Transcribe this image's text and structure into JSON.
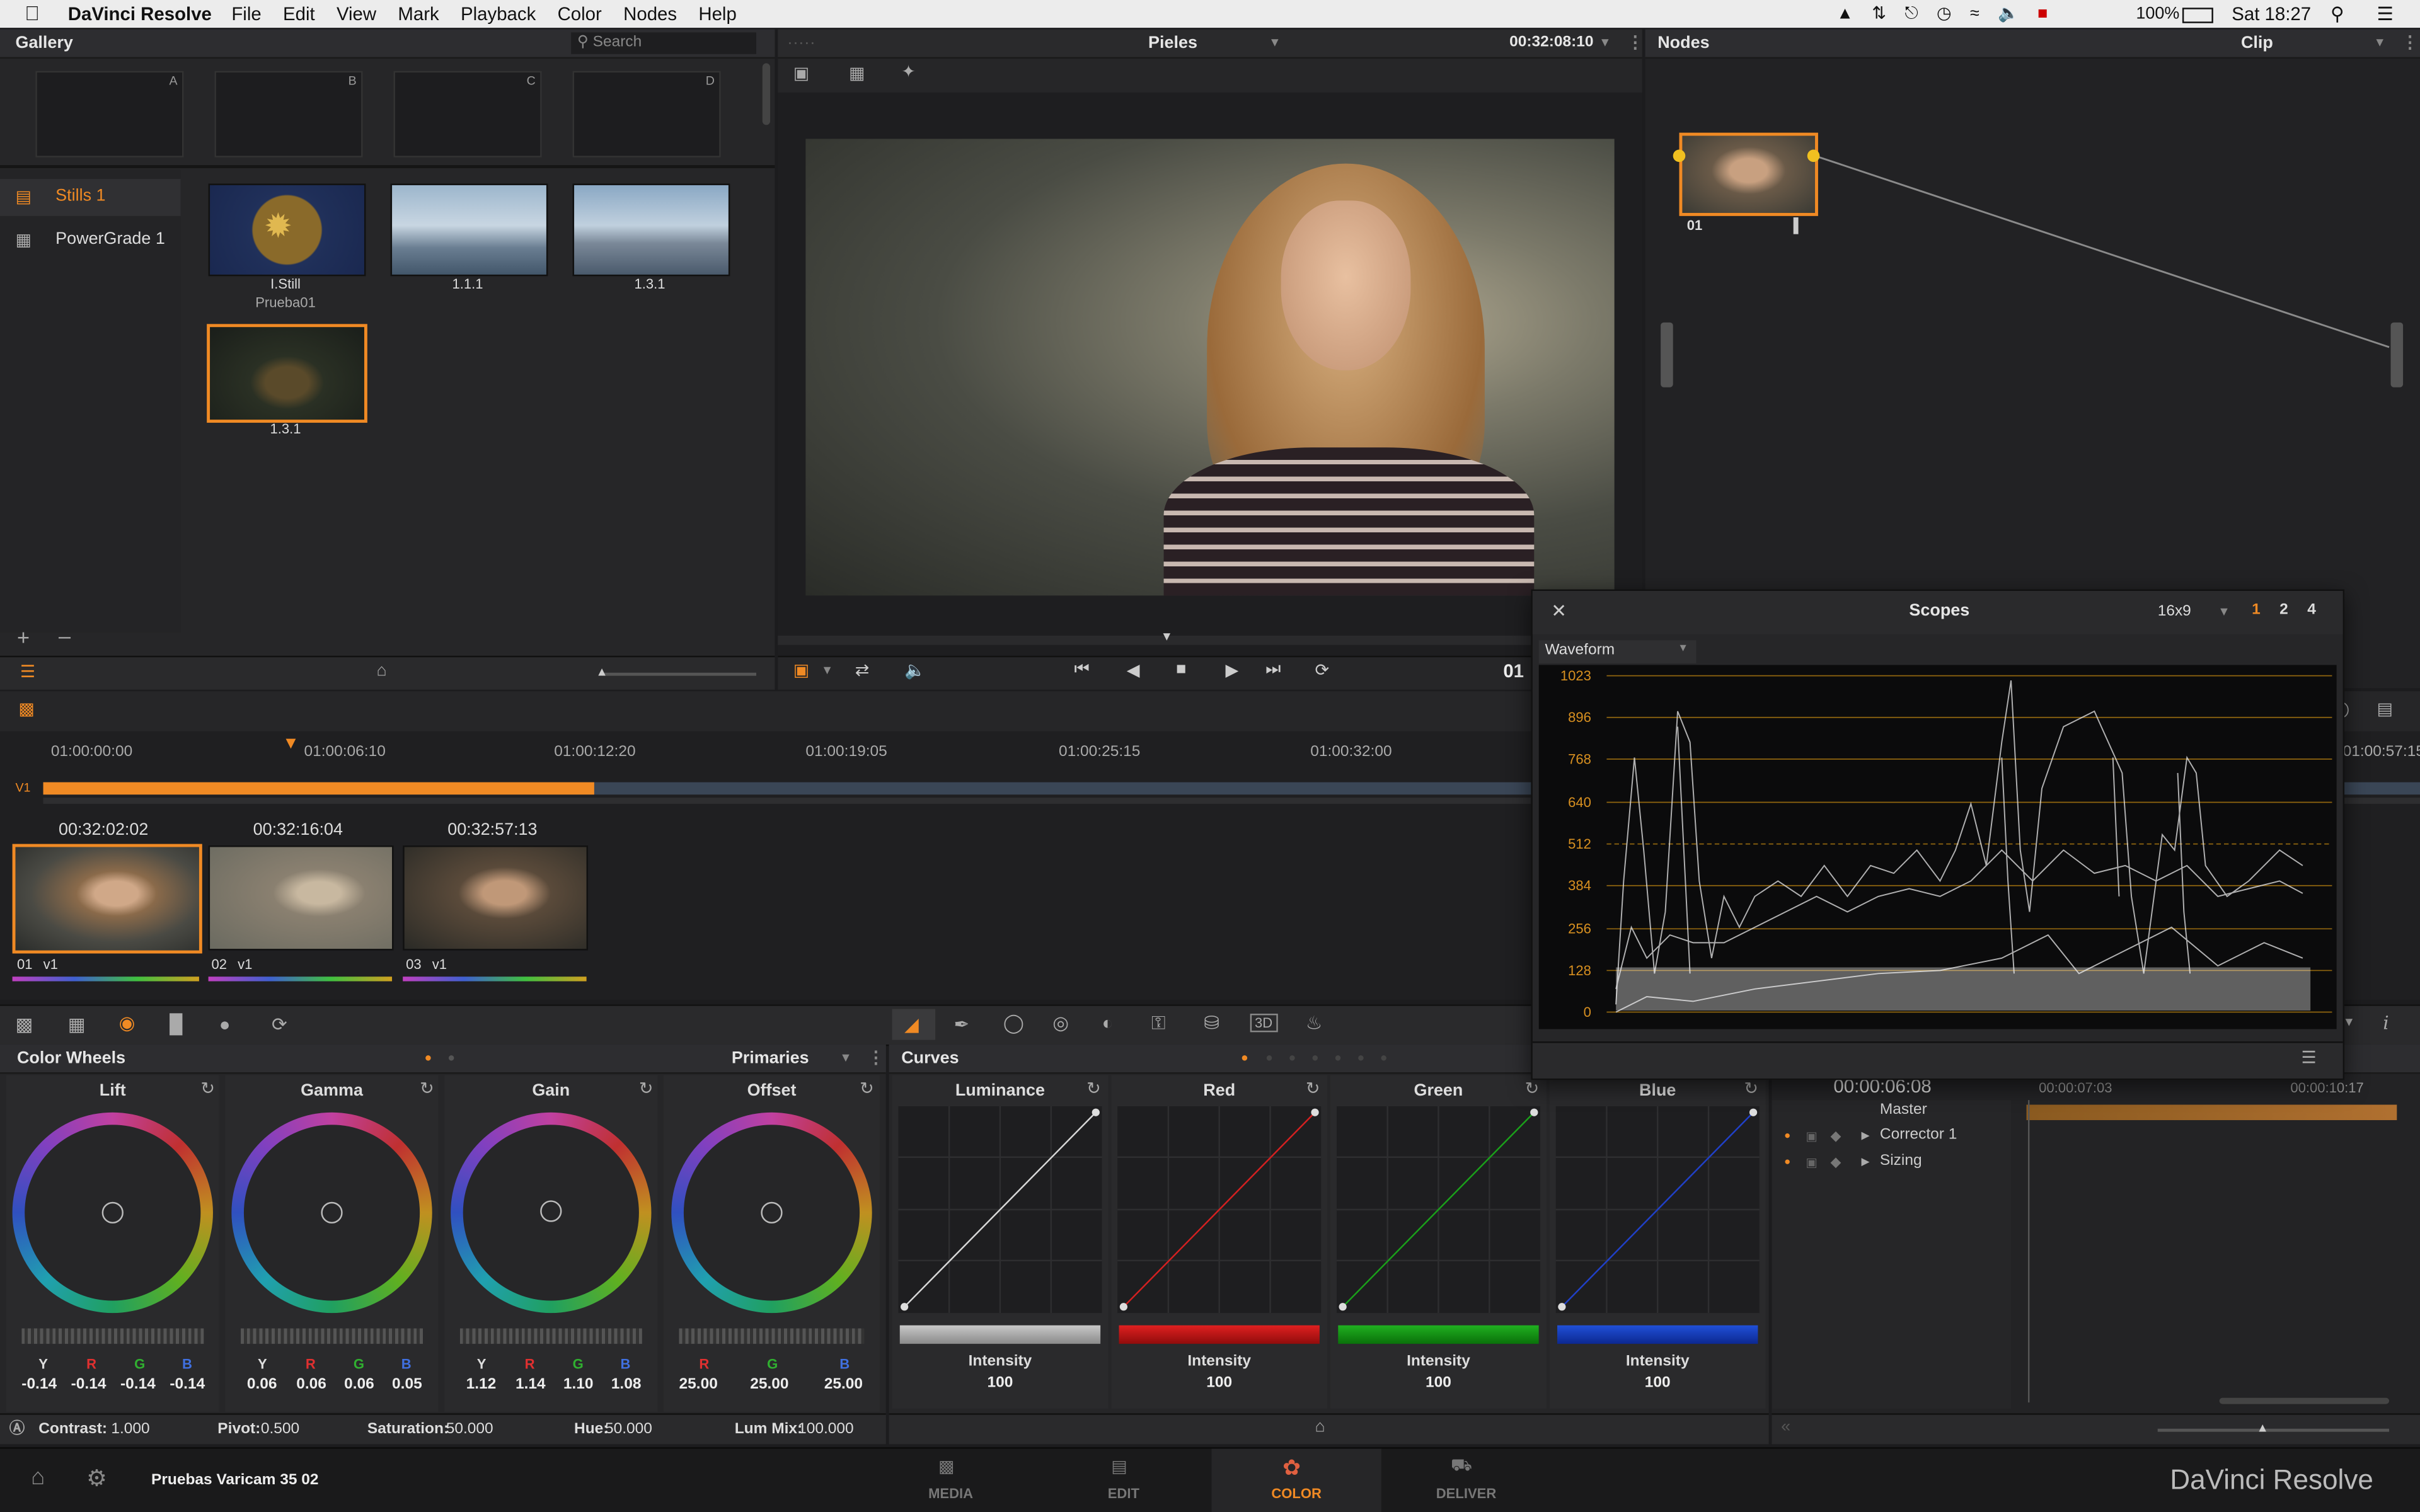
{
  "menubar": {
    "app_name": "DaVinci Resolve",
    "items": [
      "File",
      "Edit",
      "View",
      "Mark",
      "Playback",
      "Color",
      "Nodes",
      "Help"
    ],
    "battery": "100%",
    "clock": "Sat 18:27"
  },
  "gallery": {
    "title": "Gallery",
    "search_placeholder": "Search",
    "memory_slots": [
      "A",
      "B",
      "C",
      "D"
    ],
    "albums": [
      {
        "label": "Stills 1"
      },
      {
        "label": "PowerGrade 1"
      }
    ],
    "stills": [
      {
        "label": "I.Still",
        "sublabel": "Prueba01"
      },
      {
        "label": "1.1.1"
      },
      {
        "label": "1.3.1"
      },
      {
        "label": "1.3.1"
      }
    ]
  },
  "viewer": {
    "clip_name": "Pieles",
    "timecode": "00:32:08:10",
    "timecode_partial": "01"
  },
  "nodes": {
    "title": "Nodes",
    "mode": "Clip",
    "node_label": "01"
  },
  "scopes": {
    "title": "Scopes",
    "layout": "16x9",
    "tabs": [
      "1",
      "2",
      "4"
    ],
    "active_tab": "1",
    "scope_type": "Waveform",
    "scale": [
      "1023",
      "896",
      "768",
      "640",
      "512",
      "384",
      "256",
      "128",
      "0"
    ]
  },
  "timeline": {
    "ruler": [
      "01:00:00:00",
      "01:00:06:10",
      "01:00:12:20",
      "01:00:19:05",
      "01:00:25:15",
      "01:00:32:00",
      "01:00:57:15"
    ],
    "track_label": "V1",
    "playhead_fraction": 0.1,
    "clips": [
      {
        "timecode": "00:32:02:02",
        "number": "01",
        "track": "v1"
      },
      {
        "timecode": "00:32:16:04",
        "number": "02",
        "track": "v1"
      },
      {
        "timecode": "00:32:57:13",
        "number": "03",
        "track": "v1"
      }
    ]
  },
  "color_wheels": {
    "title": "Color Wheels",
    "mode": "Primaries",
    "wheels": [
      {
        "name": "Lift",
        "channels": [
          "Y",
          "R",
          "G",
          "B"
        ],
        "values": [
          "-0.14",
          "-0.14",
          "-0.14",
          "-0.14"
        ]
      },
      {
        "name": "Gamma",
        "channels": [
          "Y",
          "R",
          "G",
          "B"
        ],
        "values": [
          "0.06",
          "0.06",
          "0.06",
          "0.05"
        ]
      },
      {
        "name": "Gain",
        "channels": [
          "Y",
          "R",
          "G",
          "B"
        ],
        "values": [
          "1.12",
          "1.14",
          "1.10",
          "1.08"
        ]
      },
      {
        "name": "Offset",
        "channels": [
          "R",
          "G",
          "B"
        ],
        "values": [
          "25.00",
          "25.00",
          "25.00"
        ]
      }
    ],
    "footer": {
      "contrast_label": "Contrast:",
      "contrast": "1.000",
      "pivot_label": "Pivot:",
      "pivot": "0.500",
      "saturation_label": "Saturation:",
      "saturation": "50.000",
      "hue_label": "Hue:",
      "hue": "50.000",
      "lummix_label": "Lum Mix:",
      "lummix": "100.000"
    }
  },
  "curves": {
    "title": "Curves",
    "channels": [
      {
        "name": "Luminance",
        "intensity_label": "Intensity",
        "intensity": "100",
        "color": "#d8d8d8"
      },
      {
        "name": "Red",
        "intensity_label": "Intensity",
        "intensity": "100",
        "color": "#d42020"
      },
      {
        "name": "Green",
        "intensity_label": "Intensity",
        "intensity": "100",
        "color": "#1aa01a"
      },
      {
        "name": "Blue",
        "intensity_label": "Intensity",
        "intensity": "100",
        "color": "#2040c8"
      }
    ]
  },
  "keyframes": {
    "timecode": "00:00:06:08",
    "ruler": [
      "00:00:07:03",
      "00:00:10:17"
    ],
    "tracks": [
      "Master",
      "Corrector 1",
      "Sizing"
    ]
  },
  "bottom_bar": {
    "project_name": "Pruebas Varicam 35 02",
    "pages": [
      {
        "label": "MEDIA",
        "active": false
      },
      {
        "label": "EDIT",
        "active": false
      },
      {
        "label": "COLOR",
        "active": true
      },
      {
        "label": "DELIVER",
        "active": false
      }
    ],
    "brand": "DaVinci Resolve"
  },
  "colors": {
    "accent": "#f08a24",
    "panel": "#262628",
    "header": "#2d2d30"
  }
}
